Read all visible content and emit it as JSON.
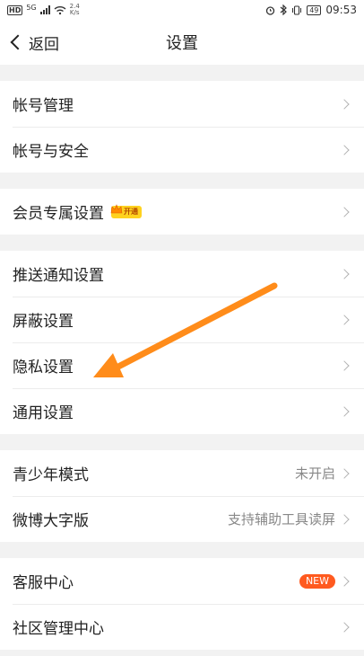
{
  "status_bar": {
    "hd": "HD",
    "net": "5G",
    "speed_value": "2.4",
    "speed_unit": "K/s",
    "battery": "49",
    "time": "09:53"
  },
  "nav": {
    "back_label": "返回",
    "title": "设置"
  },
  "groups": [
    {
      "items": [
        {
          "label": "帐号管理"
        },
        {
          "label": "帐号与安全"
        }
      ]
    },
    {
      "items": [
        {
          "label": "会员专属设置",
          "badge": "开通"
        }
      ]
    },
    {
      "items": [
        {
          "label": "推送通知设置"
        },
        {
          "label": "屏蔽设置"
        },
        {
          "label": "隐私设置"
        },
        {
          "label": "通用设置"
        }
      ]
    },
    {
      "items": [
        {
          "label": "青少年模式",
          "value": "未开启"
        },
        {
          "label": "微博大字版",
          "value": "支持辅助工具读屏"
        }
      ]
    },
    {
      "items": [
        {
          "label": "客服中心",
          "badge": "NEW"
        },
        {
          "label": "社区管理中心"
        }
      ]
    }
  ],
  "colors": {
    "annotation_arrow": "#ff8c1a",
    "new_badge": "#ff5a1f",
    "vip_badge": "#ffd21f"
  }
}
